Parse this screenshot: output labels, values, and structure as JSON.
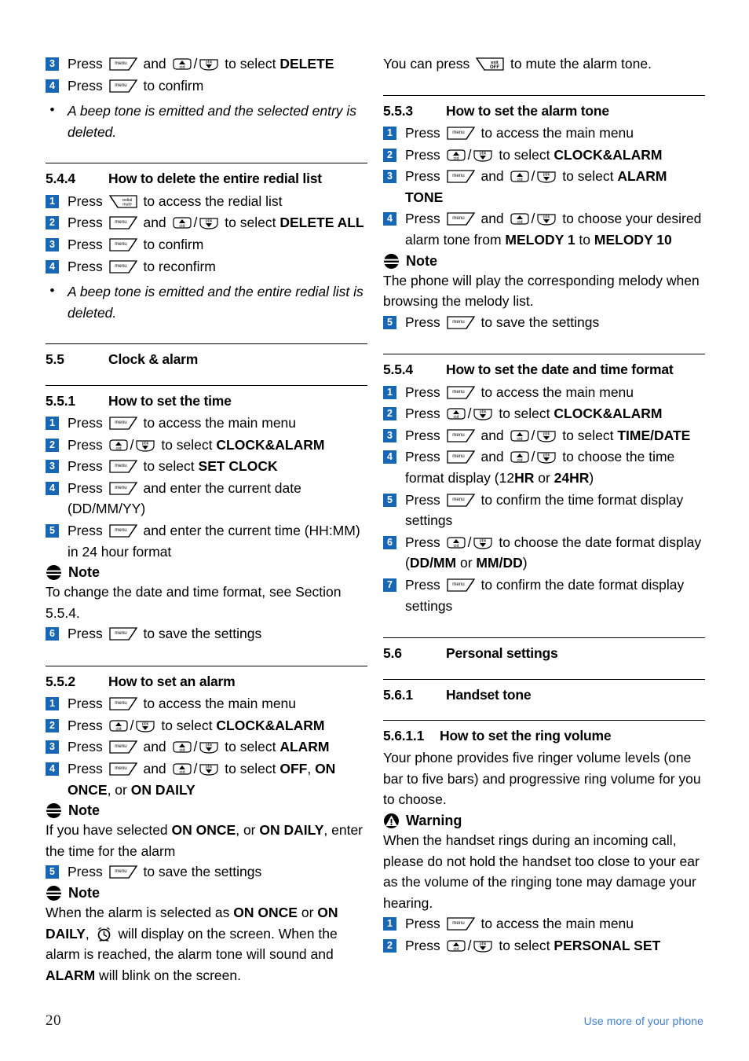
{
  "page": {
    "number": "20",
    "footer_note": "Use more of your phone",
    "accent_blue": "#1767b4",
    "footer_blue": "#3f7fd0"
  },
  "icons": {
    "menu": "menu-softkey-icon",
    "exit_off": "exit-off-softkey-icon",
    "redial_mute": "redial-mute-softkey-icon",
    "cid_up": "cid-up-arrow-icon",
    "pbk_down": "pbk-down-arrow-icon",
    "note": "note-icon",
    "warning": "warning-icon",
    "alarm_clock": "alarm-clock-icon",
    "labels": {
      "menu": "menu",
      "exit": "exit",
      "off": "OFF",
      "redial": "redial",
      "mute": "mute",
      "cid": "cid",
      "pbk": "pbk"
    }
  },
  "left_column": {
    "top_steps": [
      {
        "n": "3",
        "pre": "Press ",
        "mid": " and ",
        "post": " to select ",
        "bold": "DELETE"
      },
      {
        "n": "4",
        "pre": "Press ",
        "post": " to confirm"
      }
    ],
    "top_bullet": "A beep tone is emitted and the selected entry is deleted.",
    "sec_5_4_4": {
      "num": "5.4.4",
      "title": "How to delete the entire redial list",
      "steps": [
        {
          "n": "1",
          "pre": "Press ",
          "post": " to access the redial list"
        },
        {
          "n": "2",
          "pre": "Press ",
          "mid": " and ",
          "post": " to select ",
          "bold": "DELETE ALL"
        },
        {
          "n": "3",
          "pre": "Press ",
          "post": " to confirm"
        },
        {
          "n": "4",
          "pre": "Press ",
          "post": " to reconfirm"
        }
      ],
      "bullet": "A beep tone is emitted and the entire redial list is deleted."
    },
    "sec_5_5": {
      "num": "5.5",
      "title": "Clock & alarm"
    },
    "sec_5_5_1": {
      "num": "5.5.1",
      "title": "How to set the time",
      "steps": [
        {
          "n": "1",
          "pre": "Press ",
          "post": " to access the main menu"
        },
        {
          "n": "2",
          "pre": "Press ",
          "post": " to select ",
          "bold": "CLOCK&ALARM"
        },
        {
          "n": "3",
          "pre": "Press ",
          "post": " to select ",
          "bold": "SET CLOCK"
        },
        {
          "n": "4",
          "pre": "Press ",
          "post": " and enter the current date (DD/MM/YY)"
        },
        {
          "n": "5",
          "pre": "Press ",
          "post": " and enter the current time (HH:MM) in 24 hour format"
        }
      ],
      "note_label": "Note",
      "note_text": "To change the date and time format, see Section 5.5.4.",
      "step6": {
        "n": "6",
        "pre": "Press ",
        "post": " to save the settings"
      }
    },
    "sec_5_5_2": {
      "num": "5.5.2",
      "title": "How to set an alarm",
      "steps": [
        {
          "n": "1",
          "pre": "Press ",
          "post": " to access the main menu"
        },
        {
          "n": "2",
          "pre": "Press ",
          "post": " to select ",
          "bold": "CLOCK&ALARM"
        },
        {
          "n": "3",
          "pre": "Press ",
          "mid": " and ",
          "post": " to select ",
          "bold": "ALARM"
        },
        {
          "n": "4",
          "pre": "Press ",
          "mid": " and ",
          "post": " to select "
        }
      ],
      "step4_opts_a": "OFF",
      "step4_sep1": ", ",
      "step4_opts_b": "ON ONCE",
      "step4_sep2": ", or ",
      "step4_opts_c": "ON DAILY",
      "note1_label": "Note",
      "note1_a": "If you have selected ",
      "note1_b": "ON ONCE",
      "note1_c": ", or ",
      "note1_d": "ON DAILY",
      "note1_e": ", enter the time for the alarm",
      "step5": {
        "n": "5",
        "pre": "Press ",
        "post": " to save the settings"
      },
      "note2_label": "Note",
      "note2_a": "When the alarm is selected as ",
      "note2_b": "ON ONCE",
      "note2_c": " or ",
      "note2_d": "ON DAILY",
      "note2_e": ", ",
      "note2_f": " will display on the screen. When the alarm is reached, the alarm tone will sound and ",
      "note2_g": "ALARM",
      "note2_h": " will blink on the screen."
    }
  },
  "right_column": {
    "intro_a": "You can press ",
    "intro_b": " to mute the alarm tone.",
    "sec_5_5_3": {
      "num": "5.5.3",
      "title": "How to set the alarm tone",
      "steps": [
        {
          "n": "1",
          "pre": "Press ",
          "post": " to access the main menu"
        },
        {
          "n": "2",
          "pre": "Press ",
          "post": " to select ",
          "bold": "CLOCK&ALARM"
        },
        {
          "n": "3",
          "pre": "Press ",
          "mid": " and ",
          "post": " to select ",
          "bold": "ALARM TONE"
        }
      ],
      "step4_pre": "Press ",
      "step4_mid": " and ",
      "step4_post": " to choose your desired alarm tone from ",
      "step4_b1": "MELODY 1",
      "step4_mid2": " to ",
      "step4_b2": "MELODY 10",
      "step4_n": "4",
      "note_label": "Note",
      "note_text": "The phone will play the corresponding melody when browsing the melody list.",
      "step5": {
        "n": "5",
        "pre": "Press ",
        "post": " to save the settings"
      }
    },
    "sec_5_5_4": {
      "num": "5.5.4",
      "title": "How to set the date and time format",
      "steps": [
        {
          "n": "1",
          "pre": "Press ",
          "post": " to access the main menu"
        },
        {
          "n": "2",
          "pre": "Press ",
          "post": " to select ",
          "bold": "CLOCK&ALARM"
        },
        {
          "n": "3",
          "pre": "Press ",
          "mid": " and ",
          "post": " to select ",
          "bold": "TIME/DATE"
        }
      ],
      "step4_n": "4",
      "step4_pre": "Press ",
      "step4_mid": " and ",
      "step4_post": " to choose the time format display (",
      "step4_12": "12",
      "step4_hr": "HR",
      "step4_or": " or ",
      "step4_24hr": "24HR",
      "step4_close": ")",
      "step5": {
        "n": "5",
        "pre": "Press ",
        "post": " to confirm the time format display settings"
      },
      "step6_n": "6",
      "step6_pre": "Press ",
      "step6_post": " to choose the date format display (",
      "step6_a": "DD/MM",
      "step6_or": " or ",
      "step6_b": "MM/DD",
      "step6_close": ")",
      "step7": {
        "n": "7",
        "pre": "Press ",
        "post": " to confirm the date format display settings"
      }
    },
    "sec_5_6": {
      "num": "5.6",
      "title": "Personal settings"
    },
    "sec_5_6_1": {
      "num": "5.6.1",
      "title": "Handset tone"
    },
    "sec_5_6_1_1": {
      "num": "5.6.1.1",
      "title": "How to set the ring volume",
      "body": "Your phone provides five ringer volume levels (one bar to five bars) and progressive ring volume for you to choose.",
      "warning_label": "Warning",
      "warning_text": "When the handset rings during an incoming call, please do not hold the handset too close to your ear as the volume of the ringing tone may damage your hearing.",
      "steps": [
        {
          "n": "1",
          "pre": "Press ",
          "post": " to access the main menu"
        },
        {
          "n": "2",
          "pre": "Press ",
          "post": " to select ",
          "bold": "PERSONAL SET"
        }
      ]
    }
  }
}
